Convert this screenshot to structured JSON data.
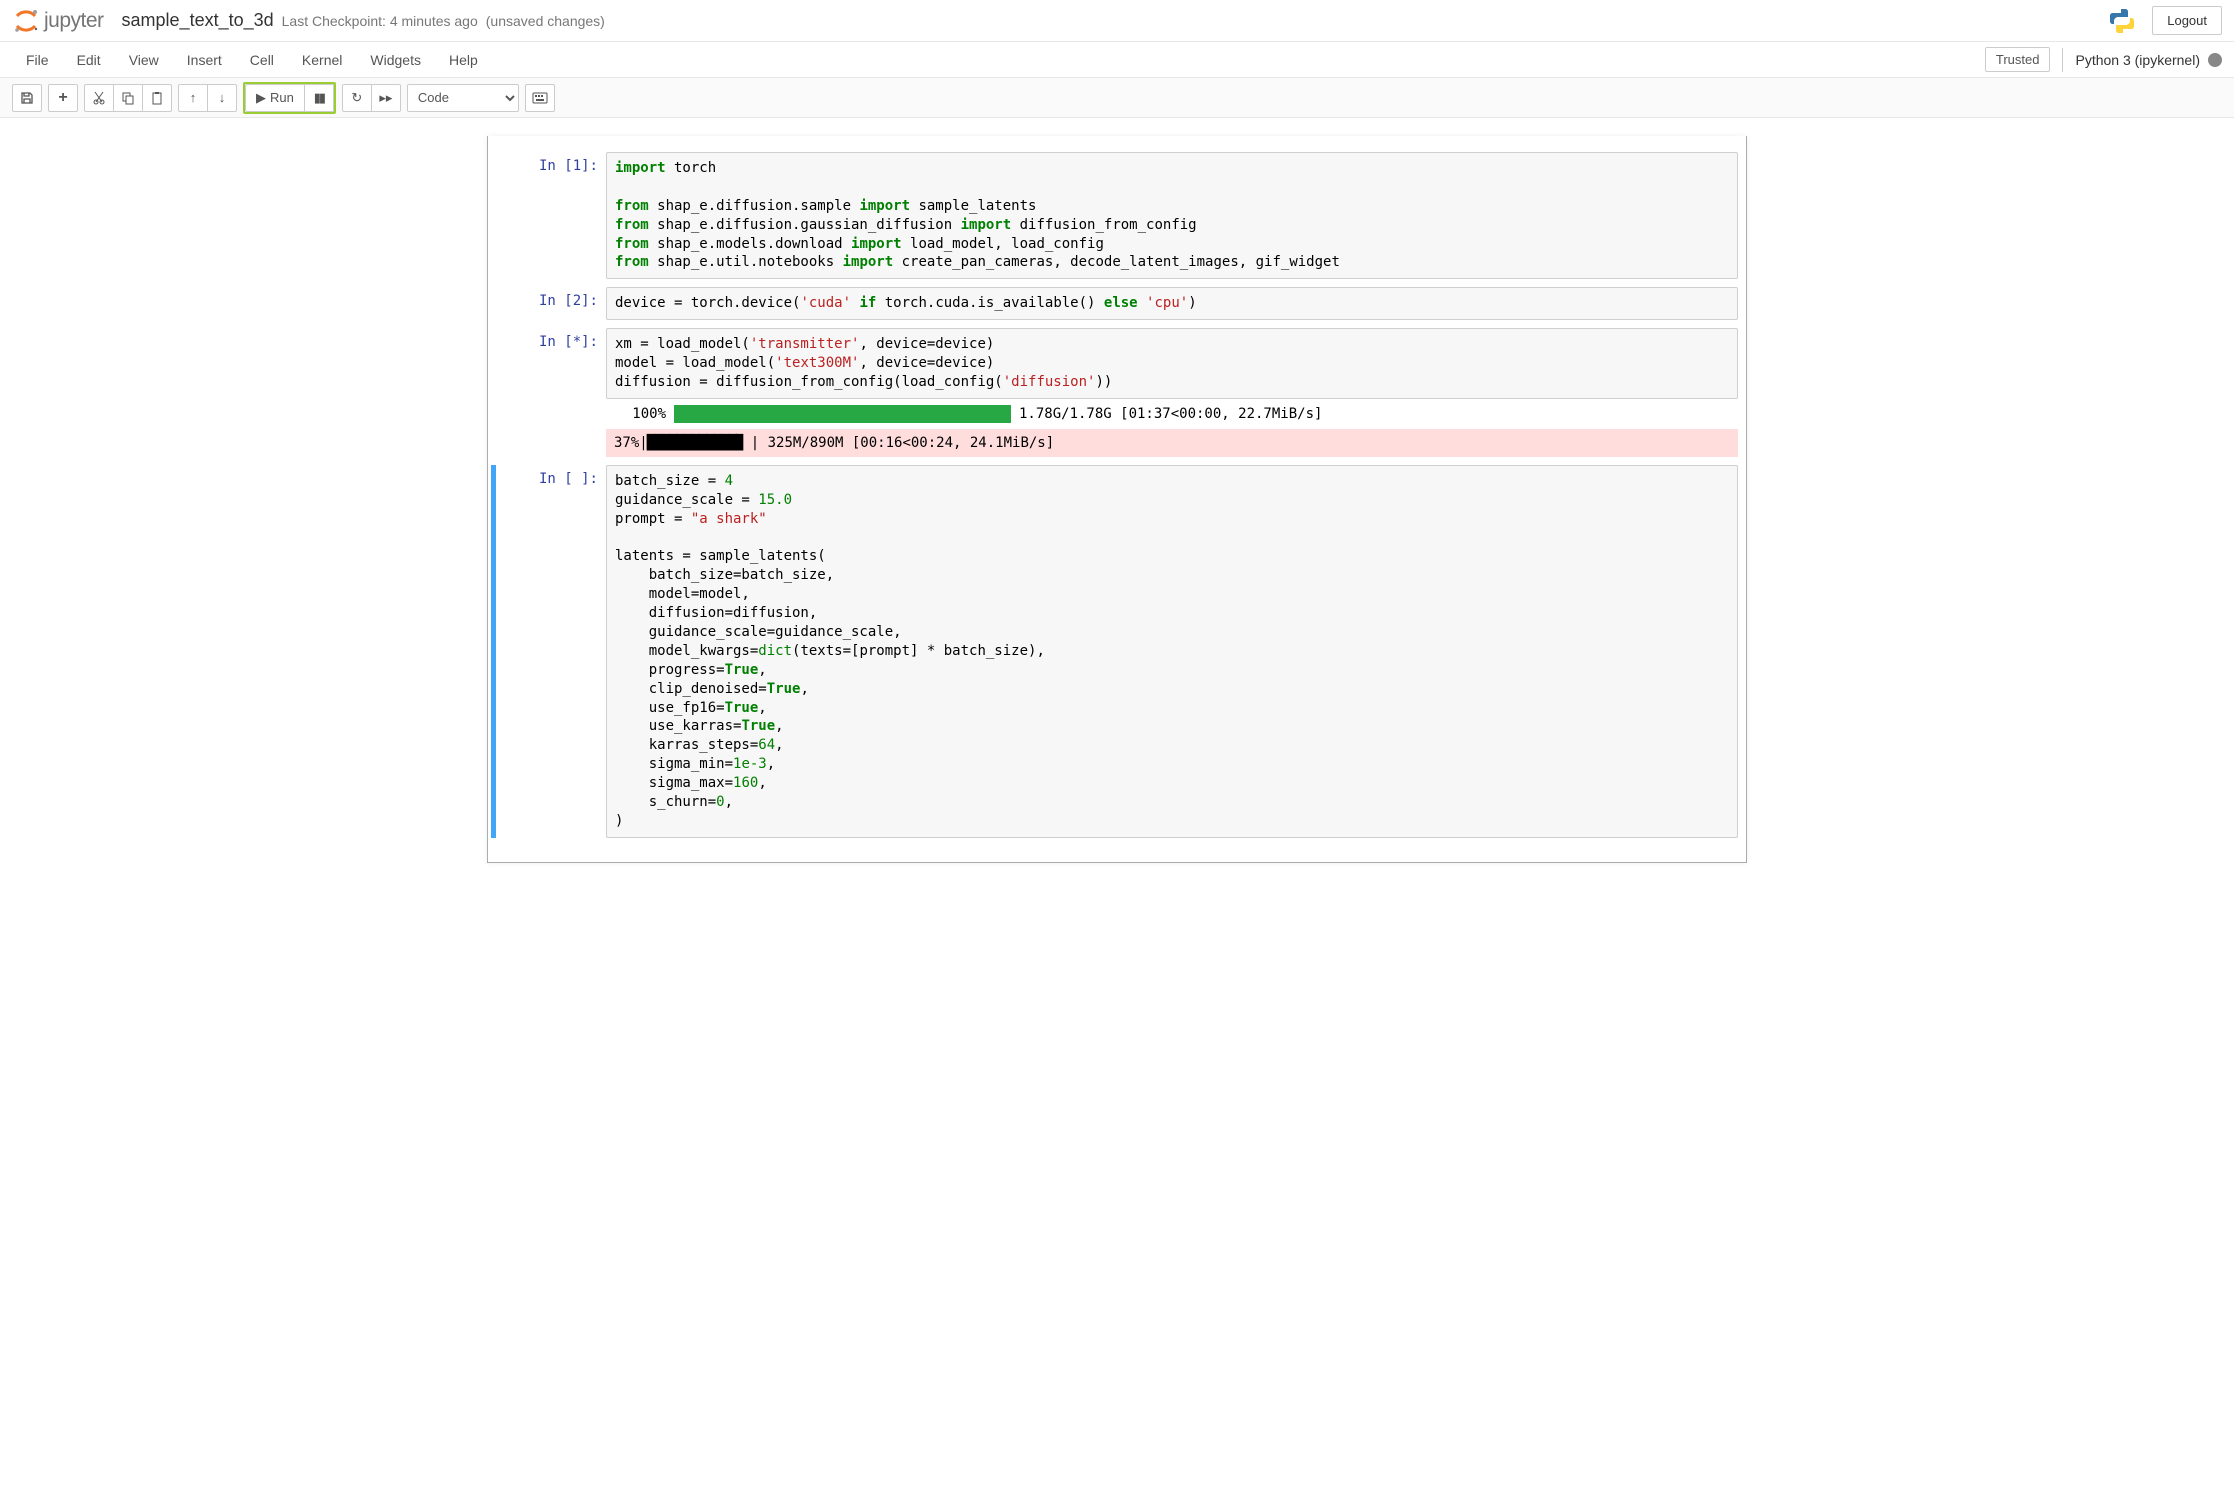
{
  "header": {
    "logo_text": "jupyter",
    "notebook_name": "sample_text_to_3d",
    "checkpoint": "Last Checkpoint: 4 minutes ago",
    "unsaved": "(unsaved changes)",
    "logout": "Logout"
  },
  "menubar": [
    "File",
    "Edit",
    "View",
    "Insert",
    "Cell",
    "Kernel",
    "Widgets",
    "Help"
  ],
  "trusted": "Trusted",
  "kernel": "Python 3 (ipykernel)",
  "toolbar": {
    "run_label": "Run",
    "celltype": "Code"
  },
  "cells": {
    "c1": {
      "prompt": "In [1]:",
      "code_html": "<span class='kw'>import</span> torch\n\n<span class='kw'>from</span> shap_e.diffusion.sample <span class='kw'>import</span> sample_latents\n<span class='kw'>from</span> shap_e.diffusion.gaussian_diffusion <span class='kw'>import</span> diffusion_from_config\n<span class='kw'>from</span> shap_e.models.download <span class='kw'>import</span> load_model, load_config\n<span class='kw'>from</span> shap_e.util.notebooks <span class='kw'>import</span> create_pan_cameras, decode_latent_images, gif_widget"
    },
    "c2": {
      "prompt": "In [2]:",
      "code_html": "device = torch.device(<span class='str'>'cuda'</span> <span class='kw'>if</span> torch.cuda.is_available() <span class='kw'>else</span> <span class='str'>'cpu'</span>)"
    },
    "c3": {
      "prompt": "In [*]:",
      "code_html": "xm = load_model(<span class='str'>'transmitter'</span>, device=device)\nmodel = load_model(<span class='str'>'text300M'</span>, device=device)\ndiffusion = diffusion_from_config(load_config(<span class='str'>'diffusion'</span>))",
      "out1": {
        "pct": "100%",
        "bar_pct": 100,
        "stats": "1.78G/1.78G [01:37<00:00, 22.7MiB/s]"
      },
      "out2": {
        "pct": " 37%",
        "bar": "|████████████▉                      ",
        "stats": "| 325M/890M [00:16<00:24, 24.1MiB/s]"
      }
    },
    "c4": {
      "prompt": "In [ ]:",
      "code_html": "batch_size = <span class='num'>4</span>\nguidance_scale = <span class='num'>15.0</span>\nprompt = <span class='str'>\"a shark\"</span>\n\nlatents = sample_latents(\n    batch_size=batch_size,\n    model=model,\n    diffusion=diffusion,\n    guidance_scale=guidance_scale,\n    model_kwargs=<span class='bi'>dict</span>(texts=[prompt] * batch_size),\n    progress=<span class='bool'>True</span>,\n    clip_denoised=<span class='bool'>True</span>,\n    use_fp16=<span class='bool'>True</span>,\n    use_karras=<span class='bool'>True</span>,\n    karras_steps=<span class='num'>64</span>,\n    sigma_min=<span class='num'>1e-3</span>,\n    sigma_max=<span class='num'>160</span>,\n    s_churn=<span class='num'>0</span>,\n)"
    }
  }
}
